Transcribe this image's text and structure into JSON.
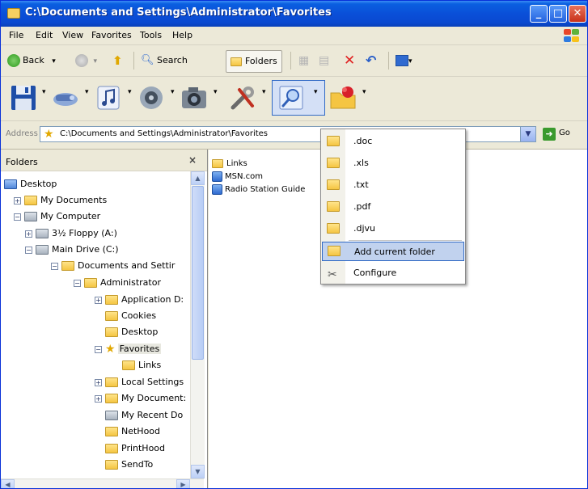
{
  "window": {
    "title": "C:\\Documents and Settings\\Administrator\\Favorites",
    "controls": {
      "minimize": "_",
      "maximize": "□",
      "close": "✕"
    }
  },
  "menubar": [
    "File",
    "Edit",
    "View",
    "Favorites",
    "Tools",
    "Help"
  ],
  "toolbar": {
    "back": "Back",
    "search": "Search",
    "folders": "Folders",
    "dropdown_arrow": "▾"
  },
  "icon_toolbar": [
    "floppy-disk-icon",
    "drive-icon",
    "music-icon",
    "media-icon",
    "camera-icon",
    "tools-icon",
    "search-magnifier-icon",
    "favorites-folder-icon"
  ],
  "address": {
    "label": "Address",
    "value": "C:\\Documents and Settings\\Administrator\\Favorites",
    "go": "Go",
    "go_arrow": "➜",
    "dropdown": "▼"
  },
  "folders_pane": {
    "title": "Folders",
    "close": "×",
    "scroll": {
      "up": "▲",
      "down": "▼",
      "left": "◀",
      "right": "▶"
    },
    "tree": [
      {
        "label": "Desktop",
        "icon": "desktop-icon",
        "expander": ""
      },
      {
        "label": "My Documents",
        "icon": "my-documents-icon",
        "expander": "+"
      },
      {
        "label": "My Computer",
        "icon": "my-computer-icon",
        "expander": "−"
      },
      {
        "label": "3½ Floppy (A:)",
        "icon": "floppy-icon",
        "expander": "+"
      },
      {
        "label": "Main Drive (C:)",
        "icon": "drive-icon",
        "expander": "−"
      },
      {
        "label": "Documents and Settir",
        "icon": "folder-icon",
        "expander": "−"
      },
      {
        "label": "Administrator",
        "icon": "folder-icon",
        "expander": "−"
      },
      {
        "label": "Application D:",
        "icon": "folder-icon",
        "expander": "+"
      },
      {
        "label": "Cookies",
        "icon": "folder-icon",
        "expander": ""
      },
      {
        "label": "Desktop",
        "icon": "folder-icon",
        "expander": ""
      },
      {
        "label": "Favorites",
        "icon": "favorites-star-icon",
        "expander": "−"
      },
      {
        "label": "Links",
        "icon": "folder-icon",
        "expander": ""
      },
      {
        "label": "Local Settings",
        "icon": "folder-icon",
        "expander": "+"
      },
      {
        "label": "My Document:",
        "icon": "folder-icon",
        "expander": "+"
      },
      {
        "label": "My Recent Do",
        "icon": "recent-icon",
        "expander": ""
      },
      {
        "label": "NetHood",
        "icon": "folder-icon",
        "expander": ""
      },
      {
        "label": "PrintHood",
        "icon": "folder-icon",
        "expander": ""
      },
      {
        "label": "SendTo",
        "icon": "folder-icon",
        "expander": ""
      }
    ]
  },
  "files": [
    {
      "label": "Links",
      "icon": "folder-icon"
    },
    {
      "label": "MSN.com",
      "icon": "link-icon"
    },
    {
      "label": "Radio Station Guide",
      "icon": "link-icon"
    }
  ],
  "dropdown_menu": [
    {
      "label": ".doc",
      "icon": "folder-icon"
    },
    {
      "label": ".xls",
      "icon": "folder-icon"
    },
    {
      "label": ".txt",
      "icon": "folder-icon"
    },
    {
      "label": ".pdf",
      "icon": "folder-icon"
    },
    {
      "label": ".djvu",
      "icon": "folder-icon"
    },
    {
      "label": "Add current folder",
      "icon": "add-folder-icon",
      "highlighted": true
    },
    {
      "label": "Configure",
      "icon": "configure-icon"
    }
  ],
  "colors": {
    "titlebar": "#0a4fd8",
    "menu_highlight": "#c1d2ee",
    "menu_highlight_border": "#316ac5",
    "chrome": "#ece9d8"
  }
}
